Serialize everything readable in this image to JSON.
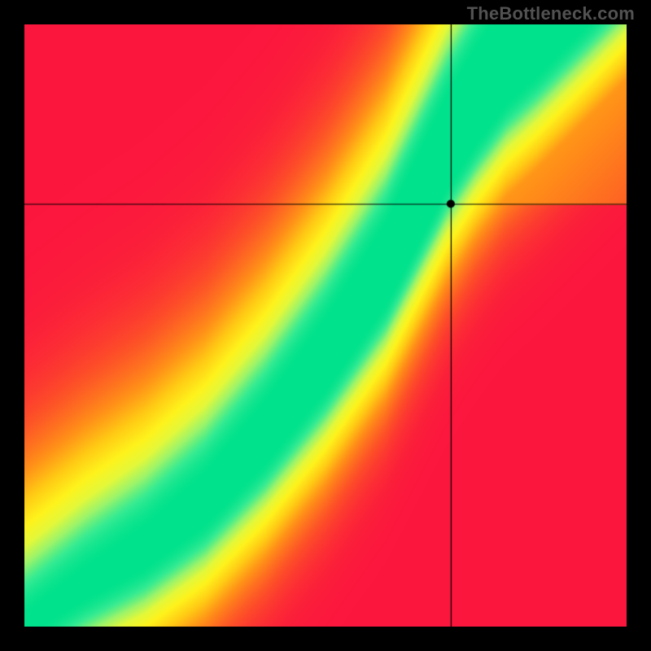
{
  "watermark": "TheBottleneck.com",
  "chart_data": {
    "type": "heatmap",
    "title": "",
    "xlabel": "",
    "ylabel": "",
    "xlim": [
      0,
      1
    ],
    "ylim": [
      0,
      1
    ],
    "crosshair": {
      "x": 0.708,
      "y": 0.702
    },
    "marker": {
      "x": 0.708,
      "y": 0.702
    },
    "ridge": {
      "description": "optimal diagonal curve (green band) through field; value 1 on ridge, falling off to 0 away from it",
      "points_xy": [
        [
          0.0,
          0.0
        ],
        [
          0.1,
          0.07
        ],
        [
          0.2,
          0.13
        ],
        [
          0.3,
          0.21
        ],
        [
          0.4,
          0.32
        ],
        [
          0.5,
          0.45
        ],
        [
          0.6,
          0.6
        ],
        [
          0.65,
          0.7
        ],
        [
          0.7,
          0.8
        ],
        [
          0.75,
          0.88
        ],
        [
          0.8,
          0.95
        ],
        [
          0.85,
          1.0
        ]
      ],
      "band_halfwidth_start": 0.01,
      "band_halfwidth_end": 0.08
    },
    "colorscale": [
      [
        0.0,
        "#fb163d"
      ],
      [
        0.2,
        "#fd4f28"
      ],
      [
        0.4,
        "#ff8f18"
      ],
      [
        0.55,
        "#ffc814"
      ],
      [
        0.7,
        "#fef31c"
      ],
      [
        0.8,
        "#e3f83a"
      ],
      [
        0.88,
        "#9cf46a"
      ],
      [
        0.95,
        "#34eb92"
      ],
      [
        1.0,
        "#00e28c"
      ]
    ]
  }
}
